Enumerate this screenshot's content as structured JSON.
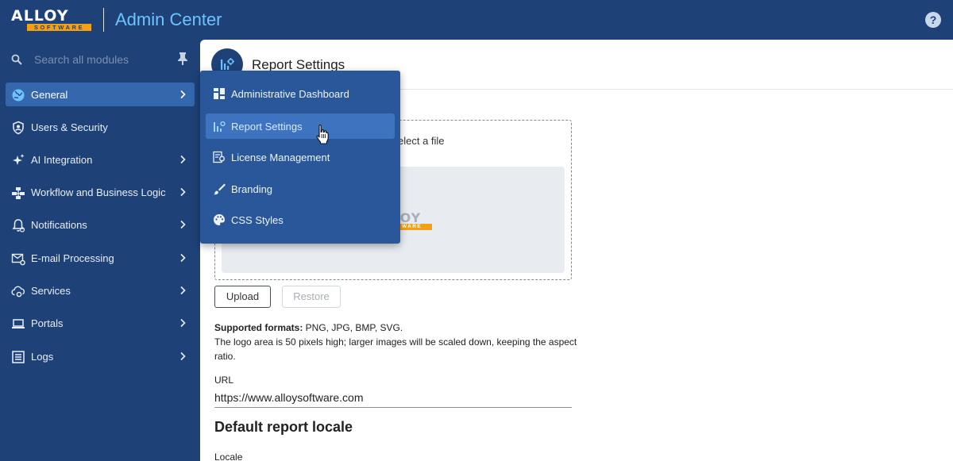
{
  "header": {
    "logo_top": "ALLOY",
    "logo_bottom": "SOFTWARE",
    "app_title": "Admin Center",
    "help_label": "?"
  },
  "sidebar": {
    "search_placeholder": "Search all modules",
    "items": [
      {
        "label": "General",
        "icon": "globe-icon",
        "active": true
      },
      {
        "label": "Users & Security",
        "icon": "shield-user-icon"
      },
      {
        "label": "AI Integration",
        "icon": "sparkles-icon"
      },
      {
        "label": "Workflow and Business Logic",
        "icon": "workflow-icon"
      },
      {
        "label": "Notifications",
        "icon": "bell-icon"
      },
      {
        "label": "E-mail Processing",
        "icon": "mail-gear-icon"
      },
      {
        "label": "Services",
        "icon": "cloud-gear-icon"
      },
      {
        "label": "Portals",
        "icon": "laptop-icon"
      },
      {
        "label": "Logs",
        "icon": "log-list-icon"
      }
    ]
  },
  "flyout": {
    "items": [
      {
        "label": "Administrative Dashboard",
        "icon": "dashboard-icon"
      },
      {
        "label": "Report Settings",
        "icon": "report-settings-icon",
        "active": true
      },
      {
        "label": "License Management",
        "icon": "license-icon"
      },
      {
        "label": "Branding",
        "icon": "brush-icon"
      },
      {
        "label": "CSS Styles",
        "icon": "palette-icon"
      }
    ]
  },
  "main": {
    "page_title": "Report Settings",
    "dropzone_text": "elect a file",
    "preview_logo_top": "LOY",
    "preview_logo_bottom": "WARE",
    "upload_label": "Upload",
    "restore_label": "Restore",
    "formats_label": "Supported formats:",
    "formats_value": " PNG, JPG, BMP, SVG.",
    "logo_note": "The logo area is 50 pixels high; larger images will be scaled down, keeping the aspect ratio.",
    "url_label": "URL",
    "url_value": "https://www.alloysoftware.com",
    "section_title": "Default report locale",
    "locale_label": "Locale"
  },
  "colors": {
    "sidebar_bg": "#1e4278",
    "active_item": "#3567ad",
    "flyout_bg": "#29579a",
    "accent": "#6ec3ff",
    "brand_orange": "#f2a115"
  }
}
